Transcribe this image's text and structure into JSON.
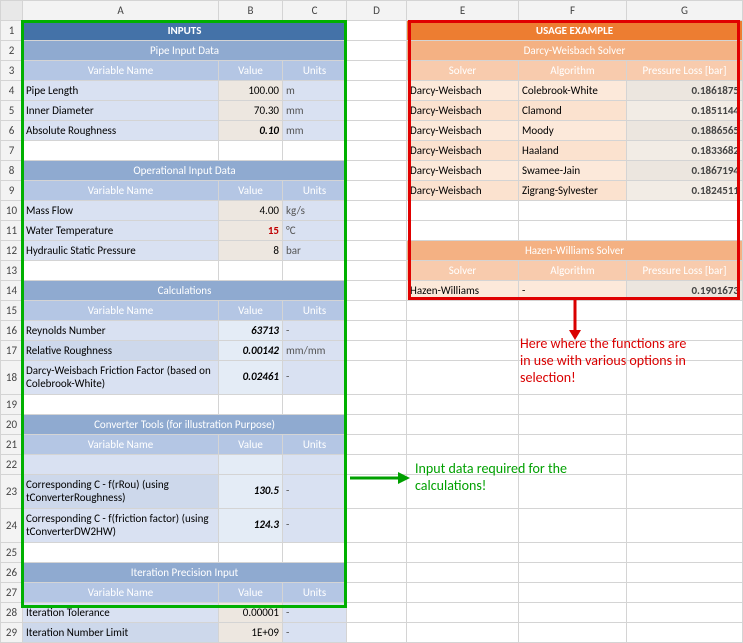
{
  "cols": [
    "A",
    "B",
    "C",
    "D",
    "E",
    "F",
    "G"
  ],
  "rowCount": 29,
  "inputs": {
    "title": "INPUTS",
    "sections": [
      {
        "header": "Pipe Input Data",
        "colhdr": {
          "a": "Variable Name",
          "b": "Value",
          "c": "Units"
        },
        "rows": [
          {
            "a": "Pipe Length",
            "b": "100.00",
            "c": "m"
          },
          {
            "a": "Inner Diameter",
            "b": "70.30",
            "c": "mm"
          },
          {
            "a": "Absolute Roughness",
            "b": "0.10",
            "c": "mm",
            "bItalic": true
          }
        ]
      },
      {
        "header": "Operational Input Data",
        "colhdr": {
          "a": "Variable Name",
          "b": "Value",
          "c": "Units"
        },
        "rows": [
          {
            "a": "Mass Flow",
            "b": "4.00",
            "c": "kg/s"
          },
          {
            "a": "Water Temperature",
            "b": "15",
            "c": "°C",
            "bRed": true,
            "bBold": true
          },
          {
            "a": "Hydraulic Static Pressure",
            "b": "8",
            "c": "bar"
          }
        ]
      },
      {
        "header": "Calculations",
        "colhdr": {
          "a": "Variable Name",
          "b": "Value",
          "c": "Units"
        },
        "rows": [
          {
            "a": "Reynolds Number",
            "b": "63713",
            "c": "-",
            "bItalic": true,
            "bBold": true
          },
          {
            "a": "Relative Roughness",
            "b": "0.00142",
            "c": "mm/mm",
            "bItalic": true,
            "bBold": true
          },
          {
            "a": "Darcy-Weisbach Friction Factor (based on Colebrook-White)",
            "b": "0.02461",
            "c": "-",
            "bItalic": true,
            "bBold": true,
            "tall": true
          }
        ]
      },
      {
        "header": "Converter Tools (for illustration Purpose)",
        "colhdr": {
          "a": "Variable Name",
          "b": "Value",
          "c": "Units"
        },
        "rows": [
          {
            "a": "",
            "b": "",
            "c": ""
          },
          {
            "a": "Corresponding C  - f(rRou) (using tConverterRoughness)",
            "b": "130.5",
            "c": "-",
            "bItalic": true,
            "bBold": true,
            "tall": true
          },
          {
            "a": "Corresponding C  - f(friction factor) (using tConverterDW2HW)",
            "b": "124.3",
            "c": "-",
            "bItalic": true,
            "bBold": true,
            "tall": true
          }
        ]
      },
      {
        "header": "Iteration Precision Input",
        "colhdr": {
          "a": "Variable Name",
          "b": "Value",
          "c": "Units"
        },
        "rows": [
          {
            "a": "Iteration Tolerance",
            "b": "0.00001",
            "c": "-"
          },
          {
            "a": "Iteration Number Limit",
            "b": "1E+09",
            "c": "-"
          }
        ]
      }
    ]
  },
  "usage": {
    "title": "USAGE EXAMPLE",
    "darcy": {
      "header": "Darcy-Weisbach Solver",
      "cols": {
        "e": "Solver",
        "f": "Algorithm",
        "g": "Pressure Loss [bar]"
      },
      "rows": [
        {
          "e": "Darcy-Weisbach",
          "f": "Colebrook-White",
          "g": "0.1861875"
        },
        {
          "e": "Darcy-Weisbach",
          "f": "Clamond",
          "g": "0.1851144"
        },
        {
          "e": "Darcy-Weisbach",
          "f": "Moody",
          "g": "0.1886565"
        },
        {
          "e": "Darcy-Weisbach",
          "f": "Haaland",
          "g": "0.1833682"
        },
        {
          "e": "Darcy-Weisbach",
          "f": "Swamee-Jain",
          "g": "0.1867194"
        },
        {
          "e": "Darcy-Weisbach",
          "f": "Zigrang-Sylvester",
          "g": "0.1824511"
        }
      ]
    },
    "hazen": {
      "header": "Hazen-Williams Solver",
      "cols": {
        "e": "Solver",
        "f": "Algorithm",
        "g": "Pressure Loss [bar]"
      },
      "rows": [
        {
          "e": "Hazen-Williams",
          "f": "-",
          "g": "0.1901673"
        }
      ]
    }
  },
  "annotations": {
    "green": "Input data required for the calculations!",
    "red": "Here where the functions are in use with various options in selection!"
  }
}
